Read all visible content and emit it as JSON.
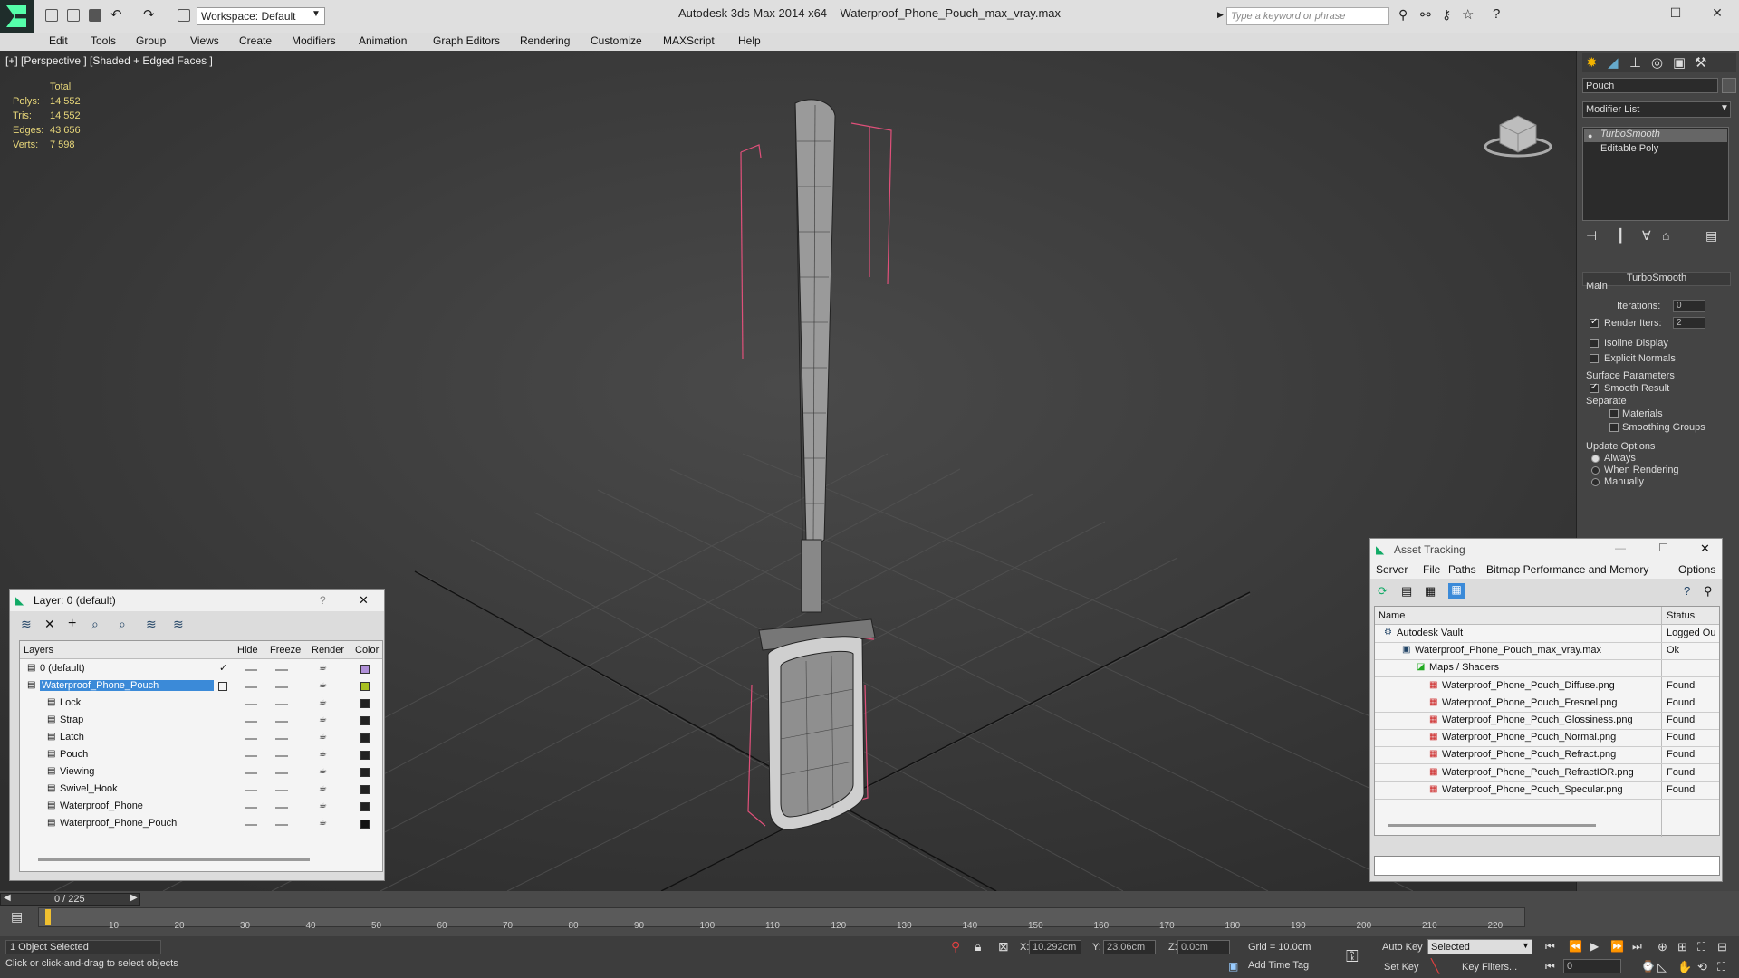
{
  "app": {
    "title": "Autodesk 3ds Max  2014 x64",
    "file": "Waterproof_Phone_Pouch_max_vray.max",
    "workspace": "Workspace: Default",
    "search_placeholder": "Type a keyword or phrase"
  },
  "menu": [
    "Edit",
    "Tools",
    "Group",
    "Views",
    "Create",
    "Modifiers",
    "Animation",
    "Graph Editors",
    "Rendering",
    "Customize",
    "MAXScript",
    "Help"
  ],
  "viewport": {
    "label": "[+] [Perspective ] [Shaded + Edged Faces ]",
    "stats": {
      "header": "Total",
      "polys_label": "Polys:",
      "polys": "14 552",
      "tris_label": "Tris:",
      "tris": "14 552",
      "edges_label": "Edges:",
      "edges": "43 656",
      "verts_label": "Verts:",
      "verts": "7 598"
    }
  },
  "command_panel": {
    "object_name": "Pouch",
    "modifier_list": "Modifier List",
    "stack": [
      "TurboSmooth",
      "Editable Poly"
    ],
    "rollout": "TurboSmooth",
    "main": "Main",
    "iterations_label": "Iterations:",
    "iterations": "0",
    "render_iters_label": "Render Iters:",
    "render_iters": "2",
    "isoline": "Isoline Display",
    "explicit": "Explicit Normals",
    "surface": "Surface Parameters",
    "smooth_result": "Smooth Result",
    "separate": "Separate",
    "materials": "Materials",
    "smoothing_groups": "Smoothing Groups",
    "update": "Update Options",
    "always": "Always",
    "when_rendering": "When Rendering",
    "manually": "Manually"
  },
  "layer_window": {
    "title": "Layer: 0 (default)",
    "help": "?",
    "columns": [
      "Layers",
      "Hide",
      "Freeze",
      "Render",
      "Color"
    ],
    "rows": [
      {
        "name": "0 (default)",
        "color": "#b090d8"
      },
      {
        "name": "Waterproof_Phone_Pouch",
        "color": "#a8c020"
      },
      {
        "name": "Lock",
        "color": "#222222"
      },
      {
        "name": "Strap",
        "color": "#222222"
      },
      {
        "name": "Latch",
        "color": "#222222"
      },
      {
        "name": "Pouch",
        "color": "#222222"
      },
      {
        "name": "Viewing",
        "color": "#222222"
      },
      {
        "name": "Swivel_Hook",
        "color": "#222222"
      },
      {
        "name": "Waterproof_Phone",
        "color": "#222222"
      },
      {
        "name": "Waterproof_Phone_Pouch",
        "color": "#111111"
      }
    ]
  },
  "asset_window": {
    "title": "Asset Tracking",
    "menu": [
      "Server",
      "File",
      "Paths",
      "Bitmap Performance and Memory",
      "Options"
    ],
    "columns": [
      "Name",
      "Status"
    ],
    "rows": [
      {
        "name": "Autodesk Vault",
        "status": "Logged Ou"
      },
      {
        "name": "Waterproof_Phone_Pouch_max_vray.max",
        "status": "Ok"
      },
      {
        "name": "Maps / Shaders",
        "status": ""
      },
      {
        "name": "Waterproof_Phone_Pouch_Diffuse.png",
        "status": "Found"
      },
      {
        "name": "Waterproof_Phone_Pouch_Fresnel.png",
        "status": "Found"
      },
      {
        "name": "Waterproof_Phone_Pouch_Glossiness.png",
        "status": "Found"
      },
      {
        "name": "Waterproof_Phone_Pouch_Normal.png",
        "status": "Found"
      },
      {
        "name": "Waterproof_Phone_Pouch_Refract.png",
        "status": "Found"
      },
      {
        "name": "Waterproof_Phone_Pouch_RefractIOR.png",
        "status": "Found"
      },
      {
        "name": "Waterproof_Phone_Pouch_Specular.png",
        "status": "Found"
      }
    ]
  },
  "timeline": {
    "frame": "0 / 225",
    "ticks": [
      "10",
      "20",
      "30",
      "40",
      "50",
      "60",
      "70",
      "80",
      "90",
      "100",
      "110",
      "120",
      "130",
      "140",
      "150",
      "160",
      "170",
      "180",
      "190",
      "200",
      "210",
      "220"
    ]
  },
  "status": {
    "selected": "1 Object Selected",
    "prompt": "Click or click-and-drag to select objects",
    "x_label": "X:",
    "x": "10.292cm",
    "y_label": "Y:",
    "y": "23.06cm",
    "z_label": "Z:",
    "z": "0.0cm",
    "grid": "Grid = 10.0cm",
    "autokey": "Auto Key",
    "setkey": "Set Key",
    "selected_mode": "Selected",
    "key_filters": "Key Filters...",
    "add_time_tag": "Add Time Tag",
    "frame_field": "0"
  }
}
